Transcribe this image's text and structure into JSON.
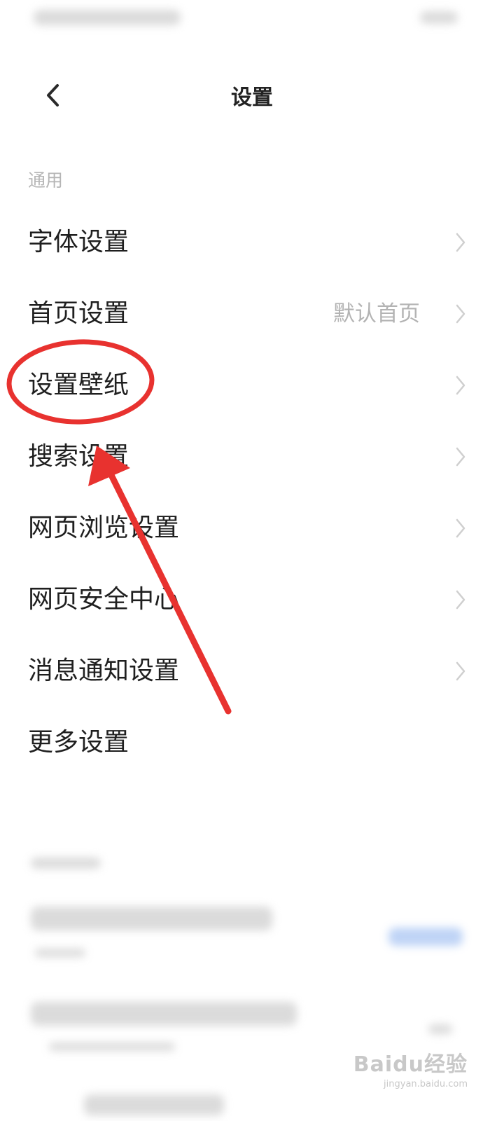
{
  "header": {
    "title": "设置"
  },
  "section": {
    "label": "通用"
  },
  "settings": [
    {
      "label": "字体设置",
      "value": "",
      "chevron": true
    },
    {
      "label": "首页设置",
      "value": "默认首页",
      "chevron": true
    },
    {
      "label": "设置壁纸",
      "value": "",
      "chevron": true
    },
    {
      "label": "搜索设置",
      "value": "",
      "chevron": true
    },
    {
      "label": "网页浏览设置",
      "value": "",
      "chevron": true
    },
    {
      "label": "网页安全中心",
      "value": "",
      "chevron": true
    },
    {
      "label": "消息通知设置",
      "value": "",
      "chevron": true
    },
    {
      "label": "更多设置",
      "value": "",
      "chevron": false
    }
  ],
  "annotation": {
    "color": "#e8322f",
    "highlighted_item": "设置壁纸"
  },
  "watermark": {
    "logo": "Baidu经验",
    "url": "jingyan.baidu.com"
  },
  "colors": {
    "background": "#ffffff",
    "text": "#1f1f1f",
    "secondary": "#b3b3b3",
    "link_blue": "#4a8cf0"
  }
}
